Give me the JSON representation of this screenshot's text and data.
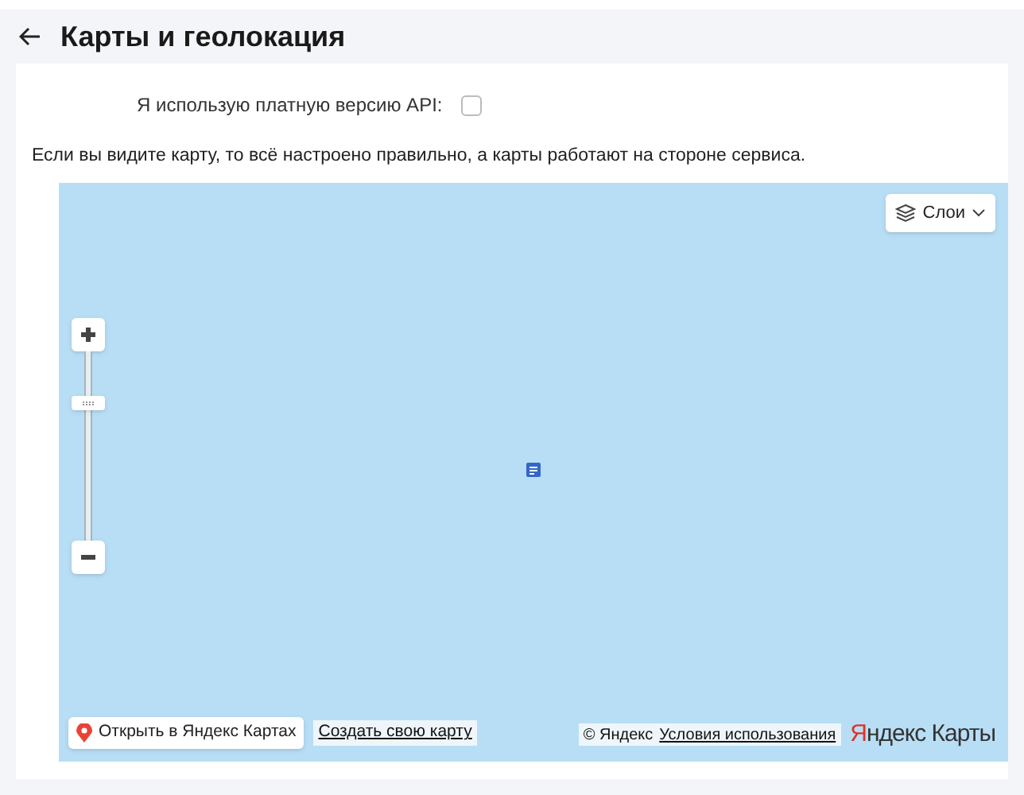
{
  "header": {
    "title": "Карты и геолокация"
  },
  "paid_api": {
    "label": "Я использую платную версию API:",
    "checked": false
  },
  "note": "Если вы видите карту, то всё настроено правильно, а карты работают на стороне сервиса.",
  "map": {
    "layers_button": "Слои",
    "zoom": {
      "level": 0.75
    },
    "open_button": "Открыть в Яндекс Картах",
    "create_link": "Создать свою карту",
    "copyright": "© Яндекс",
    "terms_link": "Условия использования",
    "logo": "Яндекс Карты"
  }
}
